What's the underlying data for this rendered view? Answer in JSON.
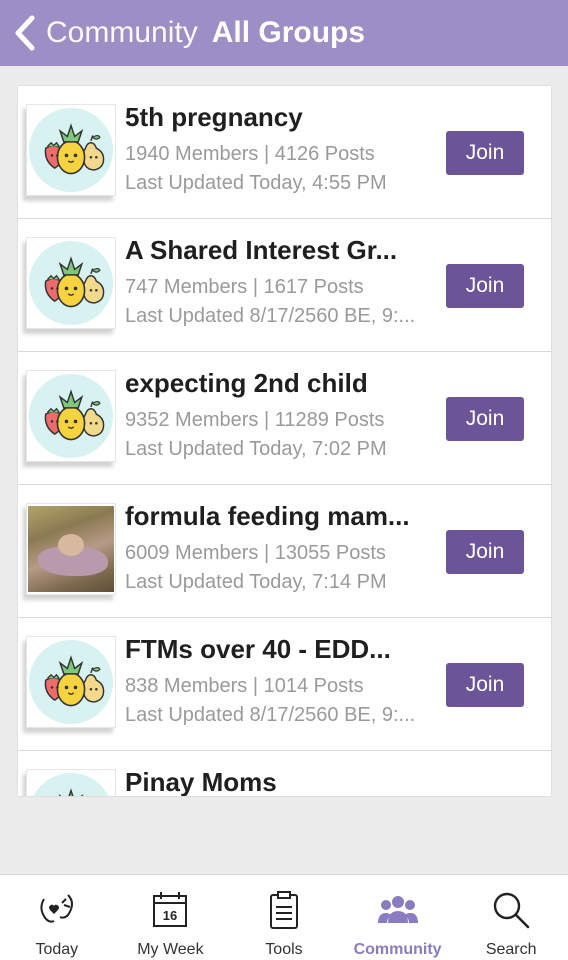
{
  "header": {
    "back_label": "Community",
    "title": "All Groups"
  },
  "colors": {
    "header_bg": "#9e8ec6",
    "join_bg": "#6b5497",
    "active_tab": "#8a7cbf"
  },
  "groups": [
    {
      "name": "5th pregnancy",
      "stats": "1940 Members | 4126 Posts",
      "updated": "Last Updated Today, 4:55 PM",
      "join_label": "Join",
      "icon": "fruit-group-icon"
    },
    {
      "name": "A Shared Interest Gr...",
      "stats": "747 Members | 1617 Posts",
      "updated": "Last Updated 8/17/2560 BE, 9:...",
      "join_label": "Join",
      "icon": "fruit-group-icon"
    },
    {
      "name": "expecting 2nd child",
      "stats": "9352 Members | 11289 Posts",
      "updated": "Last Updated Today, 7:02 PM",
      "join_label": "Join",
      "icon": "fruit-group-icon"
    },
    {
      "name": "formula feeding mam...",
      "stats": "6009 Members | 13055 Posts",
      "updated": "Last Updated Today, 7:14 PM",
      "join_label": "Join",
      "icon": "baby-photo"
    },
    {
      "name": "FTMs over 40 - EDD...",
      "stats": "838 Members | 1014 Posts",
      "updated": "Last Updated 8/17/2560 BE, 9:...",
      "join_label": "Join",
      "icon": "fruit-group-icon"
    },
    {
      "name": "Pinay Moms",
      "icon": "fruit-group-icon"
    }
  ],
  "tabs": [
    {
      "label": "Today",
      "icon": "today-icon"
    },
    {
      "label": "My Week",
      "icon": "calendar-icon",
      "badge": "16"
    },
    {
      "label": "Tools",
      "icon": "clipboard-icon"
    },
    {
      "label": "Community",
      "icon": "community-icon",
      "active": true
    },
    {
      "label": "Search",
      "icon": "search-icon"
    }
  ]
}
